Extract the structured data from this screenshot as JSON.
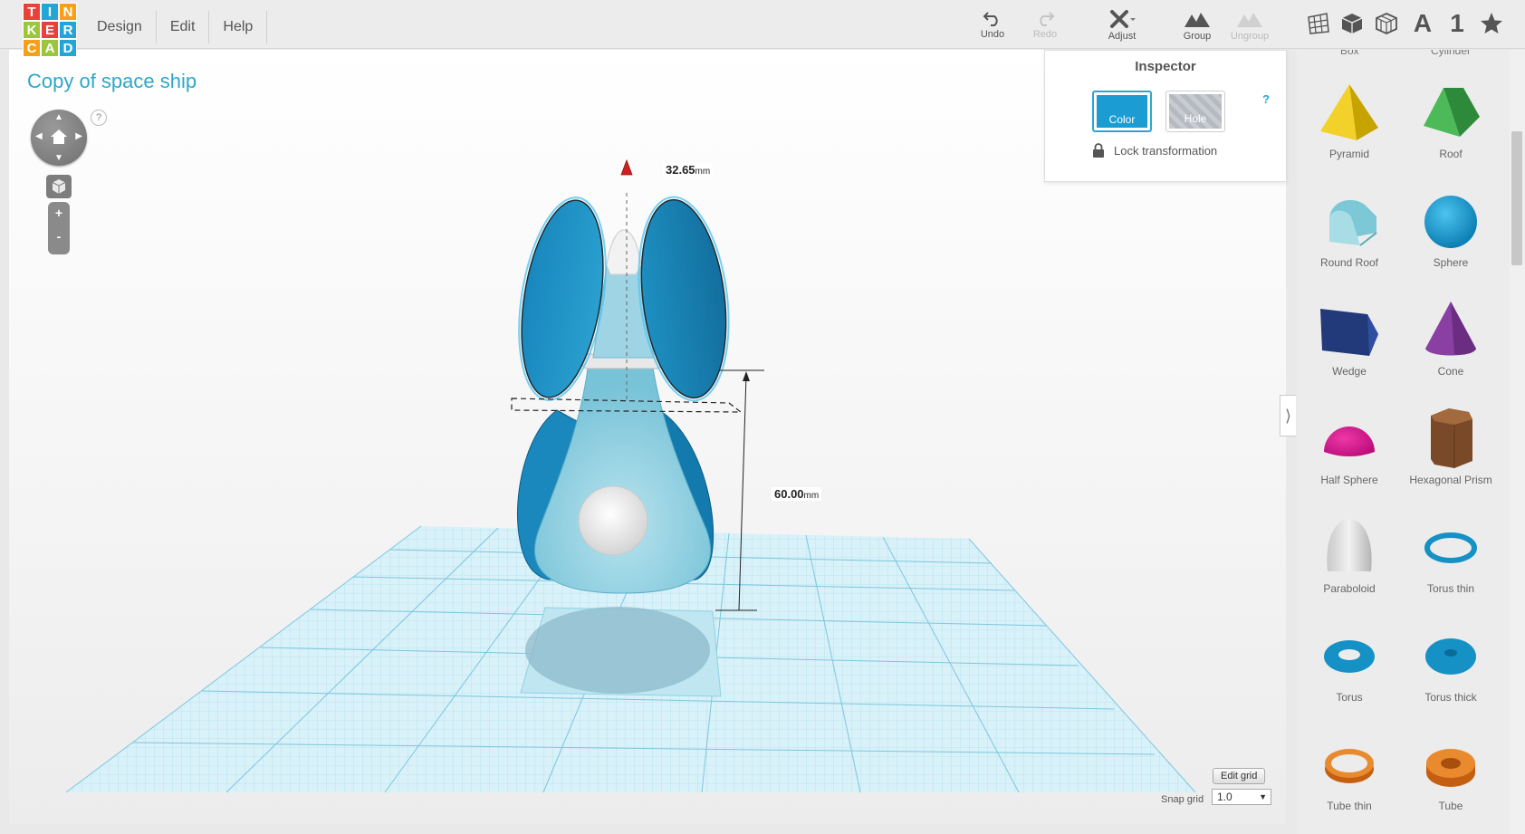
{
  "logo": {
    "letters": [
      "T",
      "I",
      "N",
      "K",
      "E",
      "R",
      "C",
      "A",
      "D"
    ],
    "colors": [
      "#e8413b",
      "#23a6d6",
      "#f6a01a",
      "#9bc53d",
      "#e8413b",
      "#23a6d6",
      "#f6a01a",
      "#9bc53d",
      "#23a6d6"
    ]
  },
  "menu": [
    {
      "label": "Design"
    },
    {
      "label": "Edit"
    },
    {
      "label": "Help"
    }
  ],
  "toolbar": {
    "undo": "Undo",
    "redo": "Redo",
    "adjust": "Adjust",
    "group": "Group",
    "ungroup": "Ungroup"
  },
  "view_icons": [
    "grid-view-icon",
    "cube-icon",
    "wireframe-cube-icon",
    "text-tool-icon",
    "number-tool-icon",
    "star-icon"
  ],
  "view_text": {
    "text_tool": "A",
    "number_tool": "1"
  },
  "design": {
    "title": "Copy of space ship"
  },
  "nav": {
    "help": "?",
    "zoom_in": "+",
    "zoom_out": "-"
  },
  "dimensions": {
    "width": "32.65",
    "width_unit": "mm",
    "height": "60.00",
    "height_unit": "mm"
  },
  "inspector": {
    "title": "Inspector",
    "color": "Color",
    "hole": "Hole",
    "help": "?",
    "lock": "Lock transformation"
  },
  "shapes": {
    "cut_top": [
      "Box",
      "Cylinder"
    ],
    "items": [
      {
        "label": "Pyramid"
      },
      {
        "label": "Roof"
      },
      {
        "label": "Round Roof"
      },
      {
        "label": "Sphere"
      },
      {
        "label": "Wedge"
      },
      {
        "label": "Cone"
      },
      {
        "label": "Half Sphere"
      },
      {
        "label": "Hexagonal Prism"
      },
      {
        "label": "Paraboloid"
      },
      {
        "label": "Torus thin"
      },
      {
        "label": "Torus"
      },
      {
        "label": "Torus thick"
      },
      {
        "label": "Tube thin"
      },
      {
        "label": "Tube"
      }
    ]
  },
  "grid": {
    "edit": "Edit grid",
    "snap_label": "Snap grid",
    "snap_value": "1.0"
  },
  "collapse": "⟩"
}
